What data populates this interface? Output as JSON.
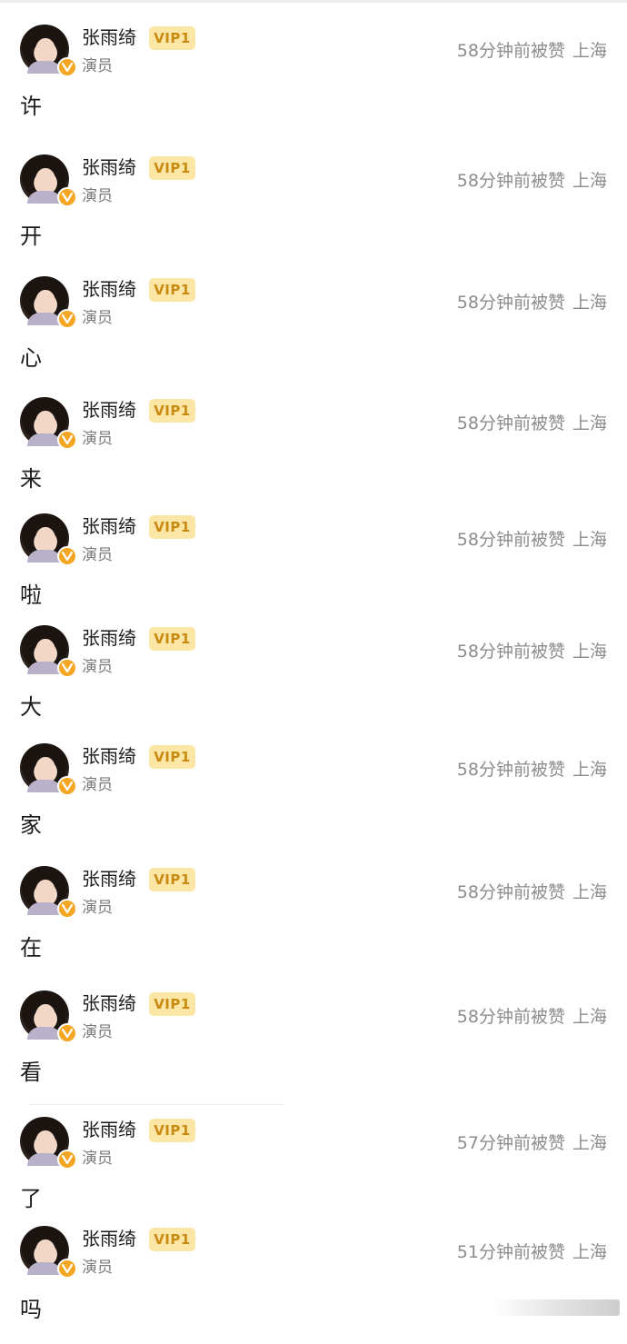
{
  "comments": [
    {
      "user": "张雨绮",
      "vip": "VIP1",
      "title": "演员",
      "time": "58分钟前被赞",
      "location": "上海",
      "text": "许"
    },
    {
      "user": "张雨绮",
      "vip": "VIP1",
      "title": "演员",
      "time": "58分钟前被赞",
      "location": "上海",
      "text": "开"
    },
    {
      "user": "张雨绮",
      "vip": "VIP1",
      "title": "演员",
      "time": "58分钟前被赞",
      "location": "上海",
      "text": "心"
    },
    {
      "user": "张雨绮",
      "vip": "VIP1",
      "title": "演员",
      "time": "58分钟前被赞",
      "location": "上海",
      "text": "来"
    },
    {
      "user": "张雨绮",
      "vip": "VIP1",
      "title": "演员",
      "time": "58分钟前被赞",
      "location": "上海",
      "text": "啦"
    },
    {
      "user": "张雨绮",
      "vip": "VIP1",
      "title": "演员",
      "time": "58分钟前被赞",
      "location": "上海",
      "text": "大"
    },
    {
      "user": "张雨绮",
      "vip": "VIP1",
      "title": "演员",
      "time": "58分钟前被赞",
      "location": "上海",
      "text": "家"
    },
    {
      "user": "张雨绮",
      "vip": "VIP1",
      "title": "演员",
      "time": "58分钟前被赞",
      "location": "上海",
      "text": "在"
    },
    {
      "user": "张雨绮",
      "vip": "VIP1",
      "title": "演员",
      "time": "58分钟前被赞",
      "location": "上海",
      "text": "看"
    },
    {
      "user": "张雨绮",
      "vip": "VIP1",
      "title": "演员",
      "time": "57分钟前被赞",
      "location": "上海",
      "text": "了"
    },
    {
      "user": "张雨绮",
      "vip": "VIP1",
      "title": "演员",
      "time": "51分钟前被赞",
      "location": "上海",
      "text": "吗"
    }
  ],
  "icons": {
    "avatar": "avatar-photo",
    "verified": "verified-v-icon"
  },
  "colors": {
    "vip_bg": "#fbe6a6",
    "vip_text": "#c98a12",
    "verified": "#f5a623",
    "meta_text": "#8c8c8c"
  }
}
